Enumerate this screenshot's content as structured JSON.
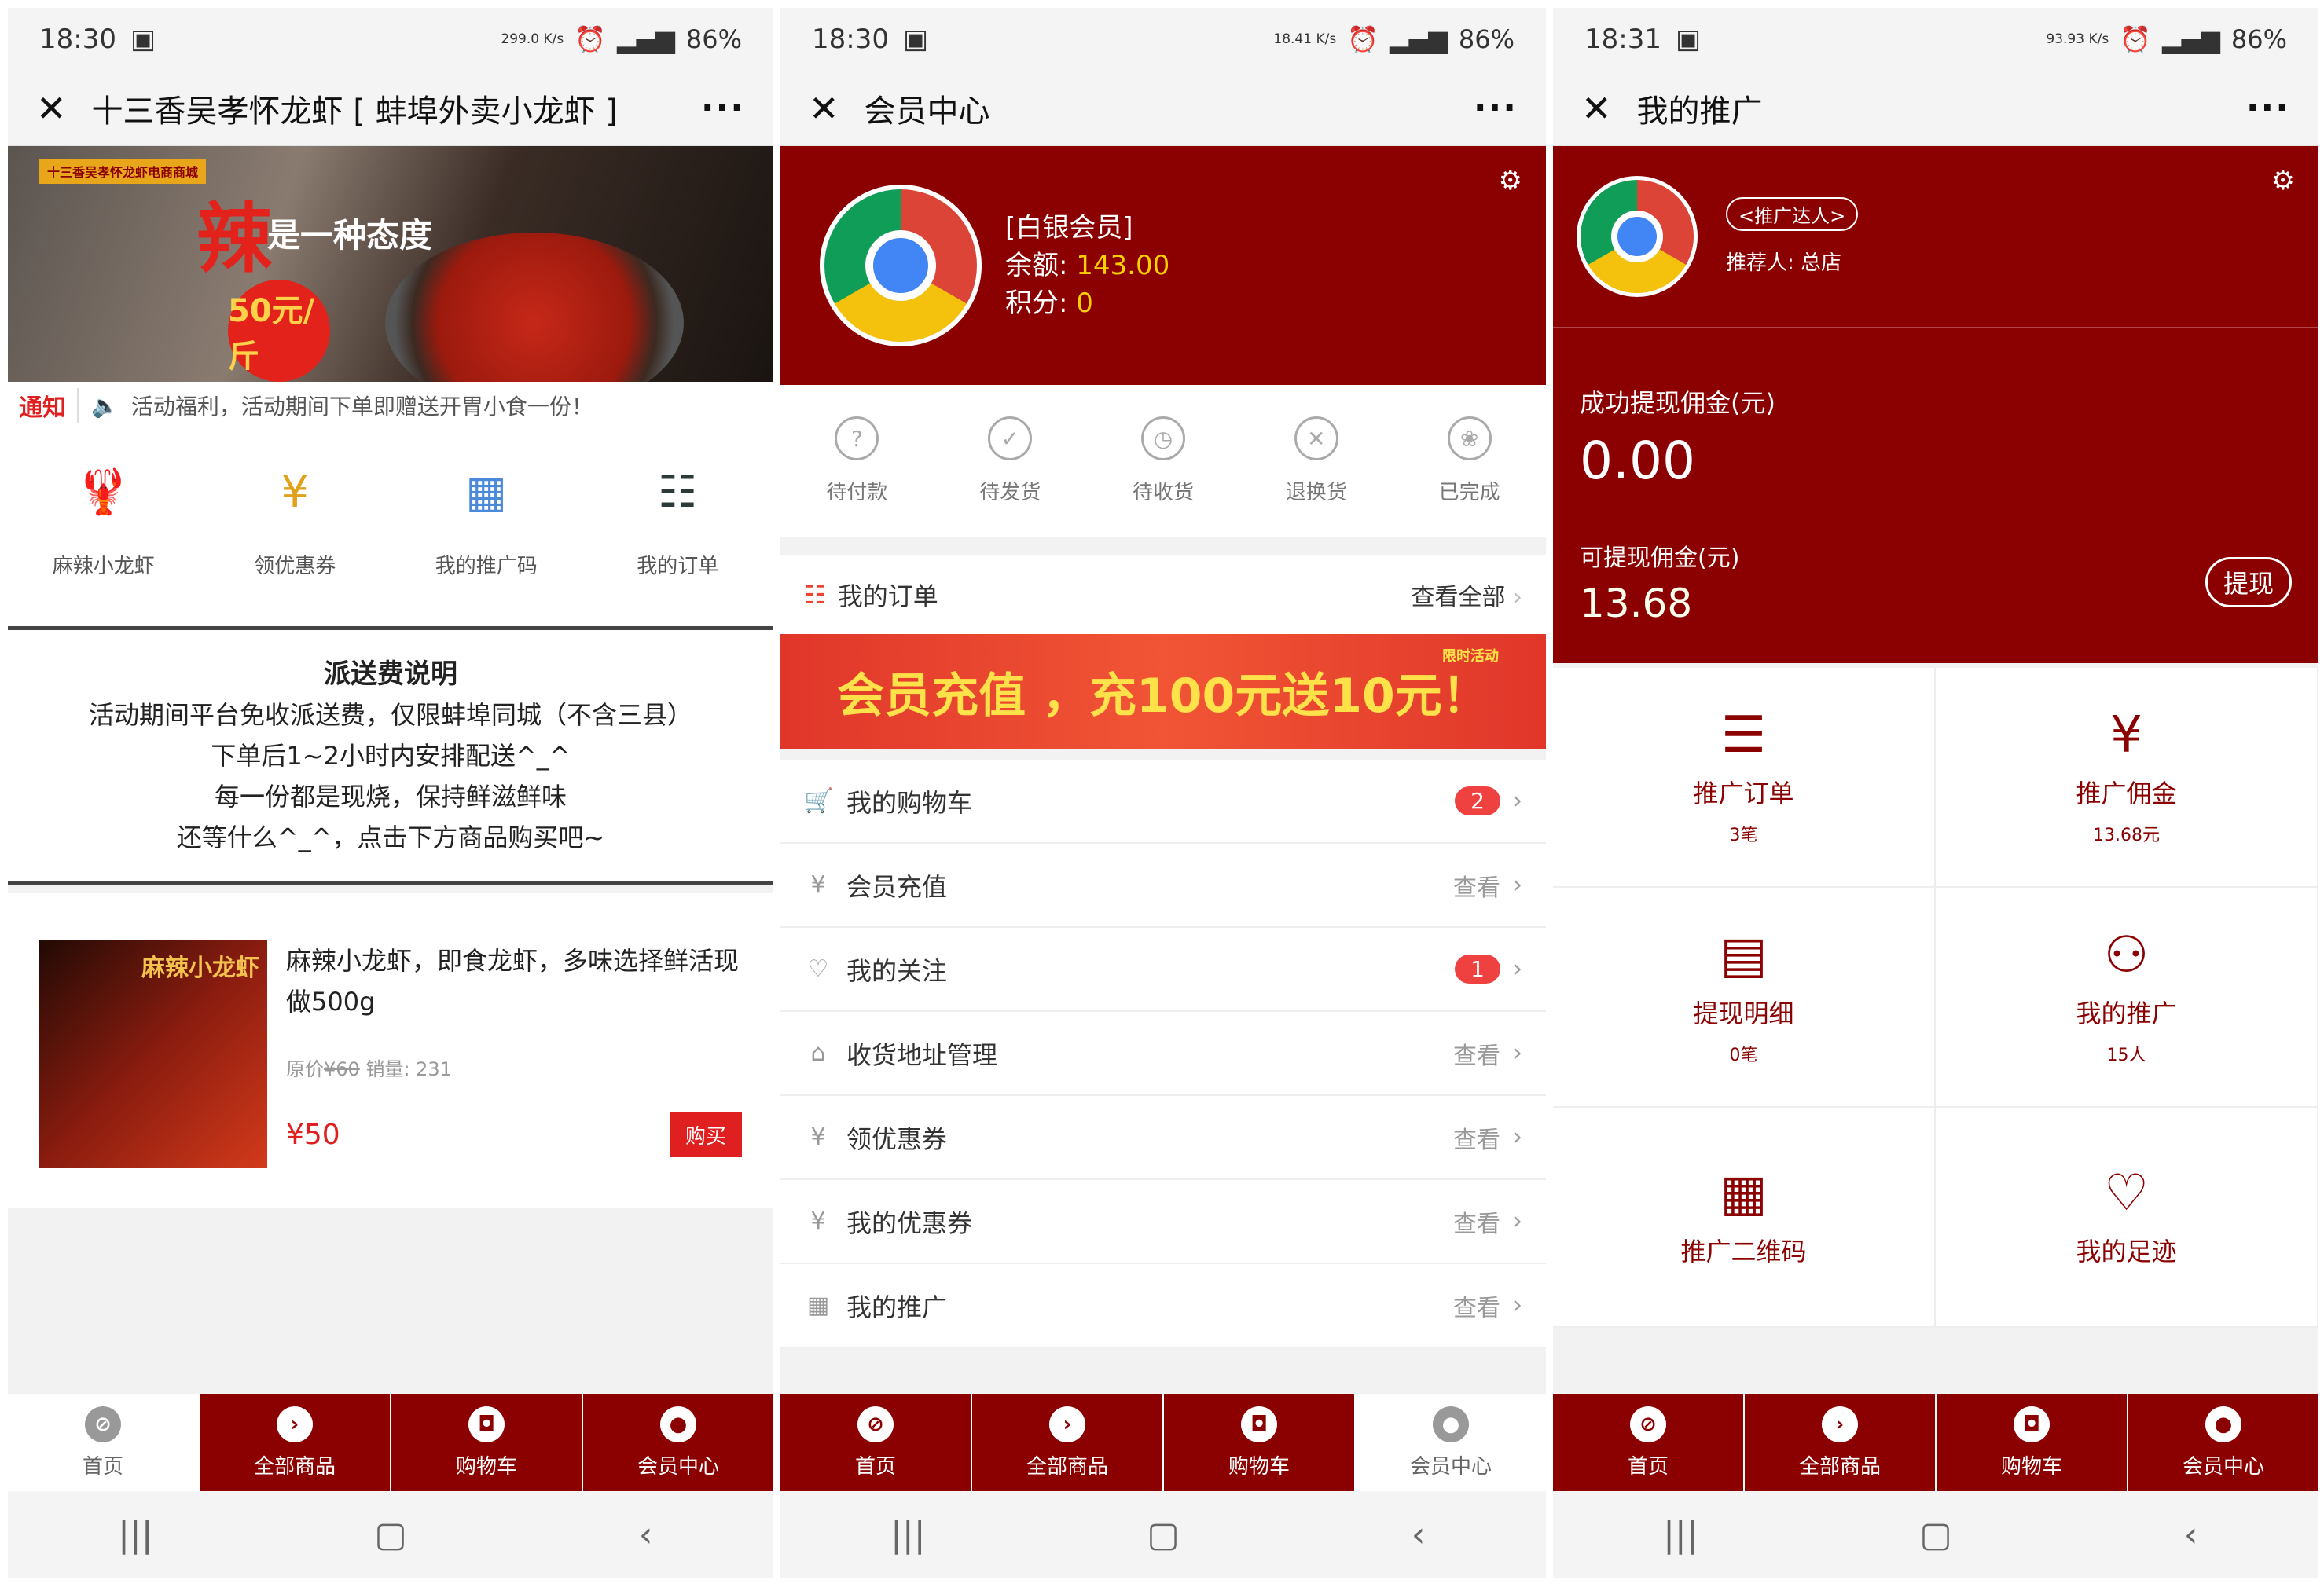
{
  "phone1": {
    "status": {
      "time": "18:30",
      "speed": "299.0 K/s",
      "battery": "86%"
    },
    "title": "十三香吴孝怀龙虾 [ 蚌埠外卖小龙虾 ]",
    "banner": {
      "tag": "十三香吴孝怀龙虾电商商城",
      "big": "辣",
      "sub": "是一种态度",
      "price": "50元/斤"
    },
    "notice": {
      "label": "通知",
      "text": "活动福利，活动期间下单即赠送开胃小食一份！"
    },
    "icons": [
      {
        "label": "麻辣小龙虾",
        "icon": "crayfish-icon"
      },
      {
        "label": "领优惠券",
        "icon": "coupon-icon"
      },
      {
        "label": "我的推广码",
        "icon": "qrcode-icon"
      },
      {
        "label": "我的订单",
        "icon": "order-icon"
      }
    ],
    "desc": {
      "title": "派送费说明",
      "lines": [
        "活动期间平台免收派送费，仅限蚌埠同城（不含三县）",
        "下单后1~2小时内安排配送^_^",
        "每一份都是现烧，保持鲜滋鲜味",
        "还等什么^_^，点击下方商品购买吧~"
      ]
    },
    "product": {
      "img_text": "麻辣小龙虾",
      "name": "麻辣小龙虾，即食龙虾，多味选择鲜活现做500g",
      "orig_label": "原价",
      "orig_price": "¥60",
      "sales": "销量: 231",
      "price": "¥50",
      "buy": "购买"
    }
  },
  "phone2": {
    "status": {
      "time": "18:30",
      "speed": "18.41 K/s",
      "battery": "86%"
    },
    "title": "会员中心",
    "member": {
      "level": "[白银会员]",
      "balance_label": "余额:",
      "balance": "143.00",
      "points_label": "积分:",
      "points": "0"
    },
    "orders": [
      {
        "label": "待付款",
        "icon": "?"
      },
      {
        "label": "待发货",
        "icon": "✓"
      },
      {
        "label": "待收货",
        "icon": "◷"
      },
      {
        "label": "退换货",
        "icon": "✕"
      },
      {
        "label": "已完成",
        "icon": "❀"
      }
    ],
    "my_order": {
      "label": "我的订单",
      "view_all": "查看全部"
    },
    "promo": {
      "text": "会员充值 ，充100元送10元！",
      "limit": "限时活动"
    },
    "list": [
      {
        "label": "我的购物车",
        "badge": "2",
        "icon": "🛒"
      },
      {
        "label": "会员充值",
        "right": "查看",
        "icon": "¥"
      },
      {
        "label": "我的关注",
        "badge": "1",
        "icon": "♡"
      },
      {
        "label": "收货地址管理",
        "right": "查看",
        "icon": "⌂"
      },
      {
        "label": "领优惠券",
        "right": "查看",
        "icon": "¥"
      },
      {
        "label": "我的优惠券",
        "right": "查看",
        "icon": "¥"
      },
      {
        "label": "我的推广",
        "right": "查看",
        "icon": "▦"
      }
    ]
  },
  "phone3": {
    "status": {
      "time": "18:31",
      "speed": "93.93 K/s",
      "battery": "86%"
    },
    "title": "我的推广",
    "head": {
      "role": "<推广达人>",
      "referrer": "推荐人: 总店",
      "success_label": "成功提现佣金(元)",
      "success_amount": "0.00",
      "available_label": "可提现佣金(元)",
      "available_amount": "13.68",
      "withdraw": "提现"
    },
    "grid": [
      {
        "label": "推广订单",
        "sub": "3笔",
        "icon": "☰"
      },
      {
        "label": "推广佣金",
        "sub": "13.68元",
        "icon": "¥"
      },
      {
        "label": "提现明细",
        "sub": "0笔",
        "icon": "▤"
      },
      {
        "label": "我的推广",
        "sub": "15人",
        "icon": "⚇"
      },
      {
        "label": "推广二维码",
        "sub": "",
        "icon": "▦"
      },
      {
        "label": "我的足迹",
        "sub": "",
        "icon": "♡"
      }
    ]
  },
  "tabs": [
    "首页",
    "全部商品",
    "购物车",
    "会员中心"
  ],
  "colors": {
    "brand": "#8b0000",
    "accent": "#e02020",
    "gold": "#ffd000"
  }
}
